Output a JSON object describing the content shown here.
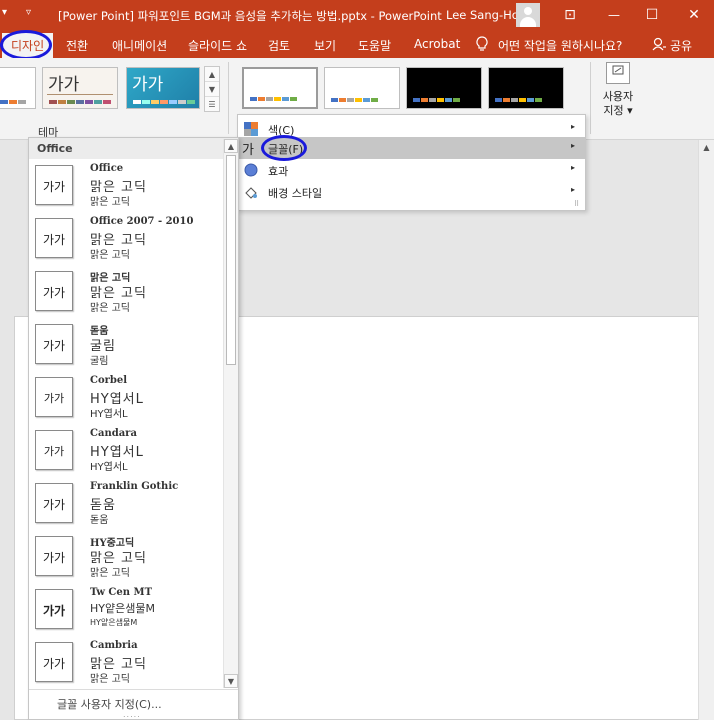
{
  "window": {
    "title": "[Power Point] 파워포인트 BGM과 음성을 추가하는 방법.pptx  -  PowerPoint",
    "user_name": "Lee Sang-Ho",
    "qat_arrow": "▾",
    "qat_customize": "▿",
    "ribbon_display_glyph": "⊡",
    "minimize_glyph": "—",
    "maximize_glyph": "☐",
    "close_glyph": "✕"
  },
  "tabs": {
    "items": [
      "디자인",
      "전환",
      "애니메이션",
      "슬라이드 쇼",
      "검토",
      "보기",
      "도움말",
      "Acrobat"
    ],
    "active": "디자인",
    "tell_me": "어떤 작업을 원하시나요?",
    "share": "공유"
  },
  "ribbon": {
    "themes_group_label": "테마",
    "theme_sample_text": "가가",
    "custom_size_label_1": "사용자",
    "custom_size_label_2": "지정",
    "custom_size_arrow": "▾"
  },
  "variant_menu": {
    "items": [
      {
        "label": "색(C)",
        "icon": "color-palette-icon"
      },
      {
        "label": "글꼴(F)",
        "icon": "font-icon",
        "icon_text": "가",
        "hover": true
      },
      {
        "label": "효과",
        "icon": "effects-icon"
      },
      {
        "label": "배경 스타일",
        "icon": "background-style-icon"
      }
    ],
    "arrow": "▸"
  },
  "font_panel": {
    "header": "Office",
    "preview_text": "가가",
    "items": [
      {
        "name": "Office",
        "heading": "맑은 고딕",
        "body": "맑은 고딕"
      },
      {
        "name": "Office 2007 - 2010",
        "heading": "맑은 고딕",
        "body": "맑은 고딕"
      },
      {
        "name": "맑은 고딕",
        "heading": "맑은 고딕",
        "body": "맑은 고딕"
      },
      {
        "name": "돋움",
        "heading": "굴림",
        "body": "굴림"
      },
      {
        "name": "Corbel",
        "heading": "HY엽서L",
        "body": "HY엽서L"
      },
      {
        "name": "Candara",
        "heading": "HY엽서L",
        "body": "HY엽서L"
      },
      {
        "name": "Franklin Gothic",
        "heading": "돋움",
        "body": "돋움"
      },
      {
        "name": "HY중고딕",
        "heading": "맑은 고딕",
        "body": "맑은 고딕"
      },
      {
        "name": "Tw Cen MT",
        "heading": "HY얕은샘물M",
        "body": "HY얕은샘물M"
      },
      {
        "name": "Cambria",
        "heading": "맑은 고딕",
        "body": "맑은 고딕"
      }
    ],
    "footer": "글꼴 사용자 지정(C)...",
    "grip": "....."
  },
  "colors": {
    "accent": "#c43e1c",
    "annotation": "#1a1adb",
    "menu_hover": "#c6c6c6"
  }
}
